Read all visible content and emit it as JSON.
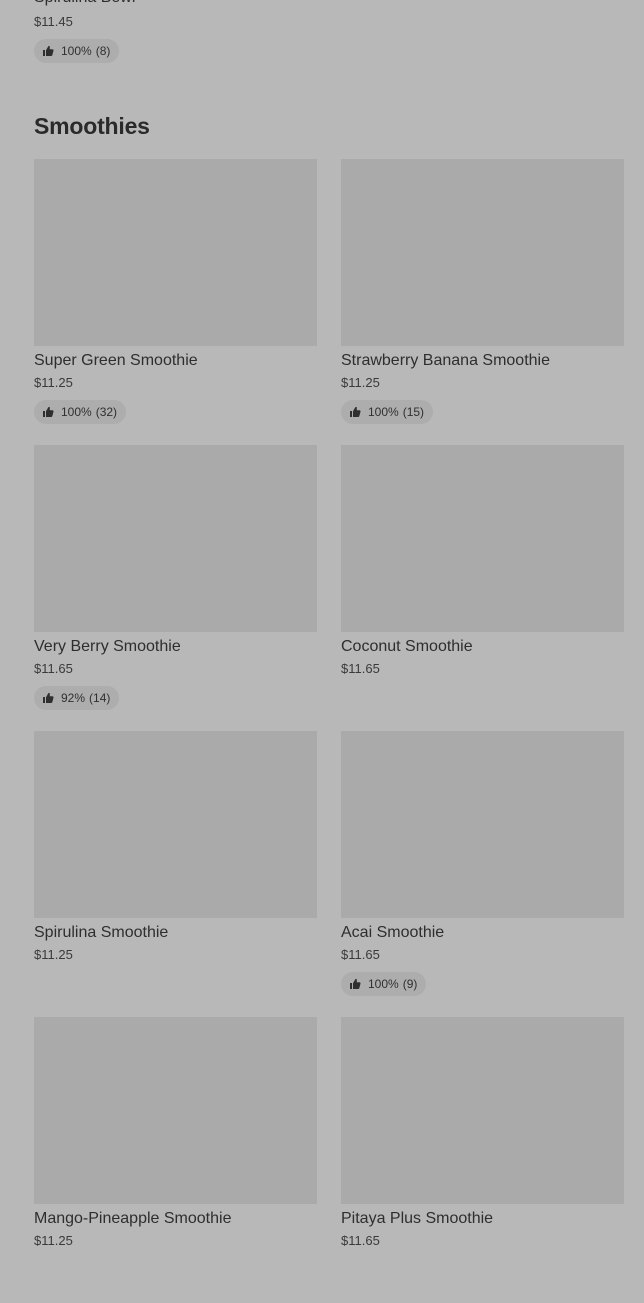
{
  "previous_section": {
    "item": {
      "name": "Spirulina Bowl",
      "price": "$11.45",
      "rating": {
        "percent": "100%",
        "count": "(8)"
      }
    }
  },
  "section": {
    "title": "Smoothies"
  },
  "items": [
    {
      "name": "Super Green Smoothie",
      "price": "$11.25",
      "rating": {
        "percent": "100%",
        "count": "(32)"
      }
    },
    {
      "name": "Strawberry Banana Smoothie",
      "price": "$11.25",
      "rating": {
        "percent": "100%",
        "count": "(15)"
      }
    },
    {
      "name": "Very Berry Smoothie",
      "price": "$11.65",
      "rating": {
        "percent": "92%",
        "count": "(14)"
      }
    },
    {
      "name": "Coconut Smoothie",
      "price": "$11.65",
      "rating": null
    },
    {
      "name": "Spirulina Smoothie",
      "price": "$11.25",
      "rating": null
    },
    {
      "name": "Acai Smoothie",
      "price": "$11.65",
      "rating": {
        "percent": "100%",
        "count": "(9)"
      }
    },
    {
      "name": "Mango-Pineapple Smoothie",
      "price": "$11.25",
      "rating": null
    },
    {
      "name": "Pitaya Plus Smoothie",
      "price": "$11.65",
      "rating": null
    }
  ],
  "icons": {
    "rating": "thumbs-up-icon"
  },
  "colors": {
    "background": "#b8b8b8",
    "image_placeholder": "#aaaaaa",
    "rating_pill": "#adadad",
    "text": "#2e2e2e"
  }
}
